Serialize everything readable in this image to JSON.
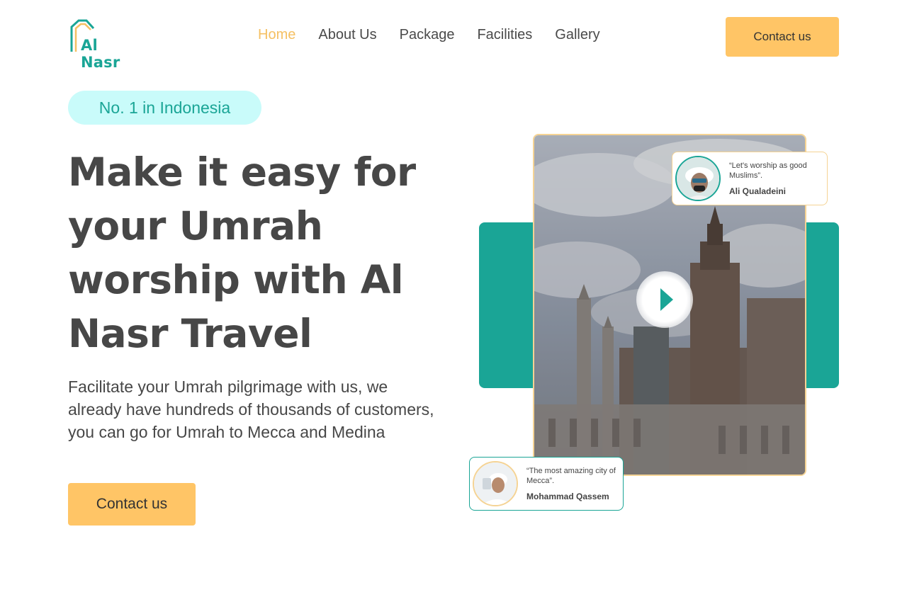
{
  "brand": {
    "name": "Al Nasr",
    "accent": "#1aa596",
    "gold": "#ffc566",
    "logo_icon": "house-outline-icon"
  },
  "nav": {
    "items": [
      {
        "label": "Home",
        "active": true
      },
      {
        "label": "About Us",
        "active": false
      },
      {
        "label": "Package",
        "active": false
      },
      {
        "label": "Facilities",
        "active": false
      },
      {
        "label": "Gallery",
        "active": false
      }
    ],
    "contact_label": "Contact us"
  },
  "hero": {
    "badge": "No. 1 in Indonesia",
    "headline": "Make it easy for your Umrah worship with Al Nasr Travel",
    "description": "Facilitate your Umrah pilgrimage with us, we already have hundreds of thousands of customers, you can go for Umrah to Mecca and Medina",
    "cta_label": "Contact us"
  },
  "media": {
    "play_icon": "play-icon",
    "testimonials": [
      {
        "quote": "“Let's worship as good Muslims”.",
        "author": "Ali Qualadeini"
      },
      {
        "quote": "“The most amazing city of Mecca”.",
        "author": "Mohammad Qassem"
      }
    ]
  }
}
